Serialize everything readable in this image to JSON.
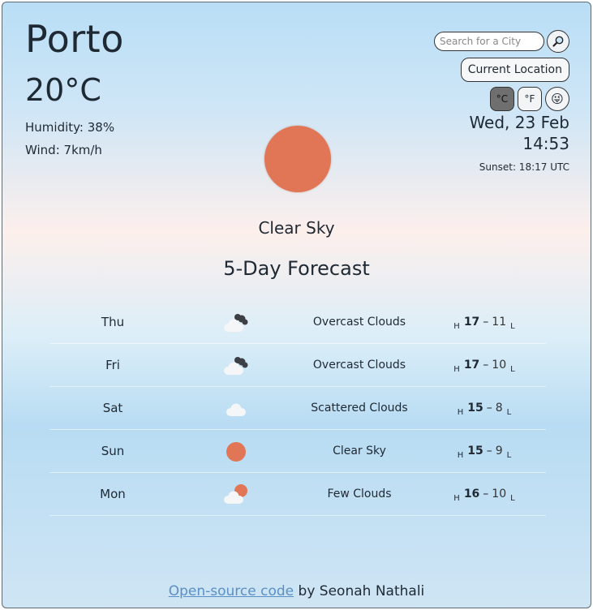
{
  "current": {
    "city": "Porto",
    "temperature": "20°C",
    "humidity": "Humidity: 38%",
    "wind": "Wind: 7km/h",
    "description": "Clear Sky",
    "date": "Wed, 23 Feb",
    "time": "14:53",
    "sunset": "Sunset: 18:17 UTC"
  },
  "search": {
    "placeholder": "Search for a City",
    "button_icon": "magnifier-icon",
    "current_location_label": "Current Location"
  },
  "units": {
    "celsius": "°C",
    "fahrenheit": "°F",
    "emoji": "😜"
  },
  "forecast": {
    "title": "5-Day Forecast",
    "days": [
      {
        "day": "Thu",
        "icon": "overcast-clouds-icon",
        "desc": "Overcast Clouds",
        "hi": "17",
        "lo": "11"
      },
      {
        "day": "Fri",
        "icon": "overcast-clouds-icon",
        "desc": "Overcast Clouds",
        "hi": "17",
        "lo": "10"
      },
      {
        "day": "Sat",
        "icon": "scattered-clouds-icon",
        "desc": "Scattered Clouds",
        "hi": "15",
        "lo": "8"
      },
      {
        "day": "Sun",
        "icon": "sun-icon",
        "desc": "Clear Sky",
        "hi": "15",
        "lo": "9"
      },
      {
        "day": "Mon",
        "icon": "few-clouds-icon",
        "desc": "Few Clouds",
        "hi": "16",
        "lo": "10"
      }
    ],
    "h_label": "H",
    "l_label": "L",
    "separator": "–"
  },
  "footer": {
    "link_text": "Open-source code",
    "suffix": " by Seonah Nathali"
  },
  "colors": {
    "sun": "#e07656",
    "cloud": "#f4f6f8",
    "dark_cloud": "#3c3f44"
  }
}
